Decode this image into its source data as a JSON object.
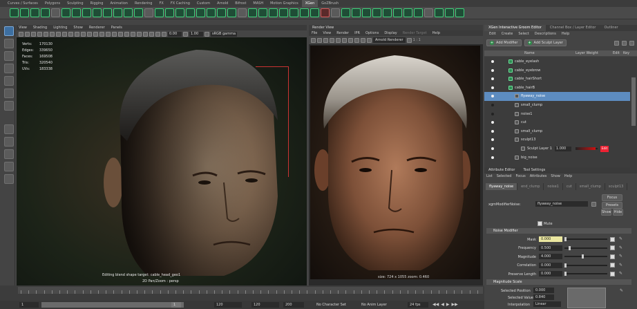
{
  "shelf": {
    "tabs": [
      "Curves / Surfaces",
      "Polygons",
      "Sculpting",
      "Rigging",
      "Animation",
      "Rendering",
      "FX",
      "FX Caching",
      "Custom",
      "Arnold",
      "Bifrost",
      "MASH",
      "Motion Graphics",
      "XGen",
      "GoZBrush"
    ],
    "active_tab": "XGen"
  },
  "viewport": {
    "menu": [
      "View",
      "Shading",
      "Lighting",
      "Show",
      "Renderer",
      "Panels"
    ],
    "field_exposure": "0.00",
    "field_gamma": "1.00",
    "colorspace": "sRGB gamma",
    "hud": [
      {
        "label": "Verts:",
        "value": "170130"
      },
      {
        "label": "Edges:",
        "value": "339650"
      },
      {
        "label": "Faces:",
        "value": "169508"
      },
      {
        "label": "Tris:",
        "value": "320540"
      },
      {
        "label": "UVs:",
        "value": "183338"
      }
    ],
    "note1": "Editing blend shape target: cable_head_geo1",
    "note2": "2D Pan/Zoom : persp"
  },
  "render_view": {
    "title": "Render View",
    "menu": [
      "File",
      "View",
      "Render",
      "IPR",
      "Options",
      "Display",
      "Render Target",
      "Help"
    ],
    "renderer": "Arnold Renderer",
    "rgb": "1 : 1",
    "footer": "size: 724 x 1055 zoom: 0.460"
  },
  "xgen": {
    "tabs": [
      "XGen Interactive Groom Editor",
      "Channel Box / Layer Editor",
      "Outliner"
    ],
    "menu": [
      "Edit",
      "Create",
      "Select",
      "Descriptions",
      "Help"
    ],
    "add_modifier": "Add Modifier",
    "add_sculpt_layer": "Add Sculpt Layer",
    "columns": {
      "name": "Name",
      "weight": "Layer Weight",
      "edit": "Edit",
      "key": "Key"
    },
    "rows": [
      {
        "name": "cable_eyelash",
        "depth": 1,
        "visible": true,
        "selected": false,
        "icon": "description"
      },
      {
        "name": "cable_eyebrow",
        "depth": 1,
        "visible": true,
        "selected": false,
        "icon": "description"
      },
      {
        "name": "cable_hairShort",
        "depth": 1,
        "visible": true,
        "selected": false,
        "icon": "description"
      },
      {
        "name": "cable_hairB",
        "depth": 1,
        "visible": true,
        "selected": false,
        "icon": "description"
      },
      {
        "name": "flyaway_noise",
        "depth": 2,
        "visible": true,
        "selected": true,
        "icon": "modifier"
      },
      {
        "name": "small_clump",
        "depth": 2,
        "visible": false,
        "selected": false,
        "icon": "modifier"
      },
      {
        "name": "noise1",
        "depth": 2,
        "visible": false,
        "selected": false,
        "icon": "modifier"
      },
      {
        "name": "cut",
        "depth": 2,
        "visible": true,
        "selected": false,
        "icon": "modifier"
      },
      {
        "name": "small_clump",
        "depth": 2,
        "visible": true,
        "selected": false,
        "icon": "modifier"
      },
      {
        "name": "sculpt13",
        "depth": 2,
        "visible": true,
        "selected": false,
        "icon": "modifier"
      },
      {
        "name": "Sculpt Layer 1",
        "depth": 3,
        "visible": true,
        "selected": false,
        "icon": "layer",
        "weight": "1.000",
        "key": "Edit"
      },
      {
        "name": "big_noise",
        "depth": 2,
        "visible": true,
        "selected": false,
        "icon": "modifier"
      }
    ],
    "sculpt_layer_progress": 0.9
  },
  "attribute_editor": {
    "tabs": [
      "Attribute Editor",
      "Tool Settings"
    ],
    "menu": [
      "List",
      "Selected",
      "Focus",
      "Attributes",
      "Show",
      "Help"
    ],
    "nodes": [
      "flyaway_noise",
      "end_clump",
      "noise1",
      "cut",
      "small_clump",
      "sculpt13"
    ],
    "active_node": "flyaway_noise",
    "node_label": "xgmModifierNoise:",
    "node_value": "flyaway_noise",
    "focus": "Focus",
    "presets": "Presets",
    "show": "Show",
    "hide": "Hide",
    "mute": "Mute",
    "section_noise": "Noise Modifier",
    "fields": [
      {
        "label": "Mask",
        "value": "0.000",
        "highlight": true,
        "level": 0.0
      },
      {
        "label": "Frequency",
        "value": "0.500",
        "highlight": false,
        "level": 0.1
      },
      {
        "label": "Magnitude",
        "value": "4.000",
        "highlight": false,
        "level": 0.4
      },
      {
        "label": "Correlation",
        "value": "0.000",
        "highlight": false,
        "level": 0.0
      },
      {
        "label": "Preserve Length",
        "value": "0.000",
        "highlight": false,
        "level": 0.0
      }
    ],
    "section_magnitude": "Magnitude Scale",
    "selected_position_label": "Selected Position",
    "selected_position": "0.000",
    "selected_value_label": "Selected Value",
    "selected_value": "0.840",
    "interpolation_label": "Interpolation",
    "interpolation": "Linear"
  },
  "timeline": {
    "start": "1",
    "range_start": "1",
    "range_end": "120",
    "current": "120",
    "end": "200",
    "character_set": "No Character Set",
    "anim_layer": "No Anim Layer",
    "fps": "24 fps"
  }
}
